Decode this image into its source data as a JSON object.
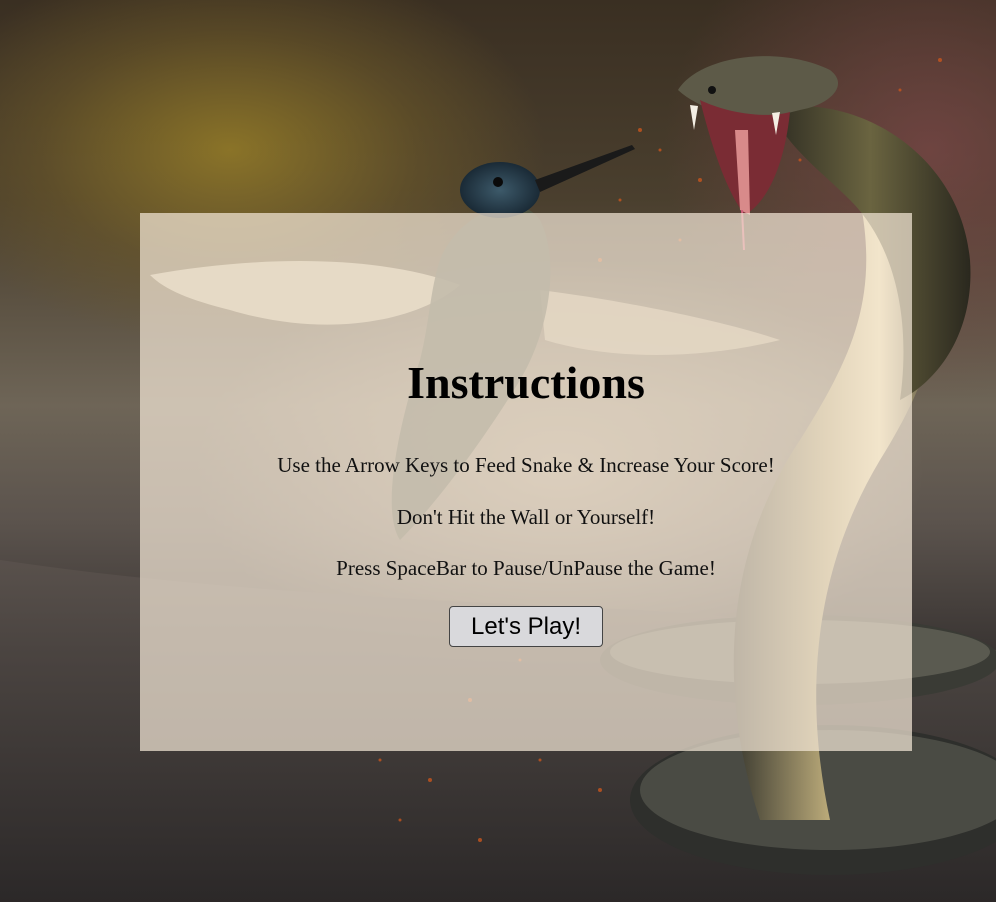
{
  "overlay": {
    "title": "Instructions",
    "instructions": [
      "Use the Arrow Keys to Feed Snake & Increase Your Score!",
      "Don't Hit the Wall or Yourself!",
      "Press SpaceBar to Pause/UnPause the Game!"
    ],
    "play_button_label": "Let's Play!"
  },
  "colors": {
    "panel_background": "#f2e6d6",
    "text": "#111111",
    "button_background": "#d9d9dc"
  },
  "background": {
    "subjects": [
      "hummingbird",
      "cobra"
    ]
  }
}
